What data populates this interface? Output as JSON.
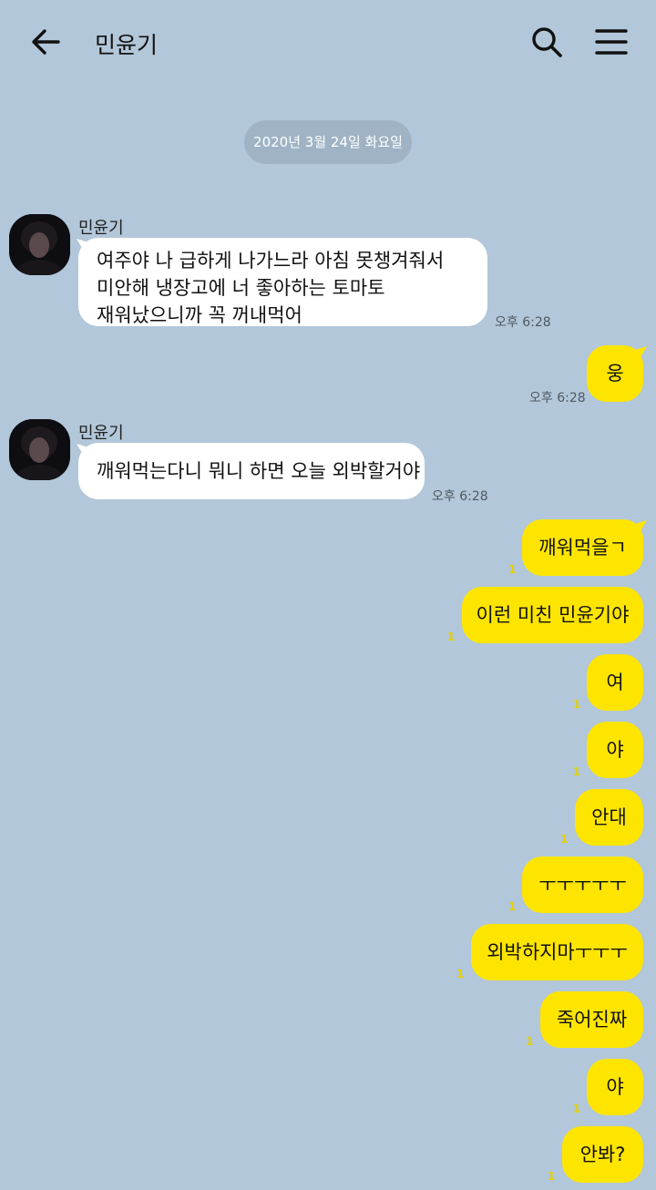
{
  "header": {
    "title": "민윤기",
    "back_icon": "arrow-left-icon",
    "search_icon": "search-icon",
    "menu_icon": "hamburger-menu-icon"
  },
  "date_divider": "2020년 3월 24일 화요일",
  "colors": {
    "background": "#b2c7d9",
    "outgoing_bubble": "#fee500",
    "incoming_bubble": "#ffffff",
    "unread_count": "#e6d000"
  },
  "messages": [
    {
      "direction": "in",
      "sender": "민윤기",
      "lines": [
        "여주야 나 급하게 나가느라 아침 못챙겨줘서",
        "미안해 냉장고에 너 좋아하는 토마토",
        "재워났으니까 꼭 꺼내먹어"
      ],
      "time": "오후 6:28"
    },
    {
      "direction": "out",
      "text": "웅",
      "time": "오후 6:28"
    },
    {
      "direction": "in",
      "sender": "민윤기",
      "text": "깨워먹는다니 뭐니 하면 오늘 외박할거야",
      "time": "오후 6:28"
    },
    {
      "direction": "out",
      "text": "깨워먹을ㄱ",
      "unread": "1"
    },
    {
      "direction": "out",
      "text": "이런 미친 민윤기야",
      "unread": "1"
    },
    {
      "direction": "out",
      "text": "여",
      "unread": "1"
    },
    {
      "direction": "out",
      "text": "야",
      "unread": "1"
    },
    {
      "direction": "out",
      "text": "안대",
      "unread": "1"
    },
    {
      "direction": "out",
      "text": "ㅜㅜㅜㅜㅜ",
      "unread": "1"
    },
    {
      "direction": "out",
      "text": "외박하지마ㅜㅜㅜ",
      "unread": "1"
    },
    {
      "direction": "out",
      "text": "죽어진짜",
      "unread": "1"
    },
    {
      "direction": "out",
      "text": "야",
      "unread": "1"
    },
    {
      "direction": "out",
      "text": "안봐?",
      "unread": "1"
    }
  ]
}
